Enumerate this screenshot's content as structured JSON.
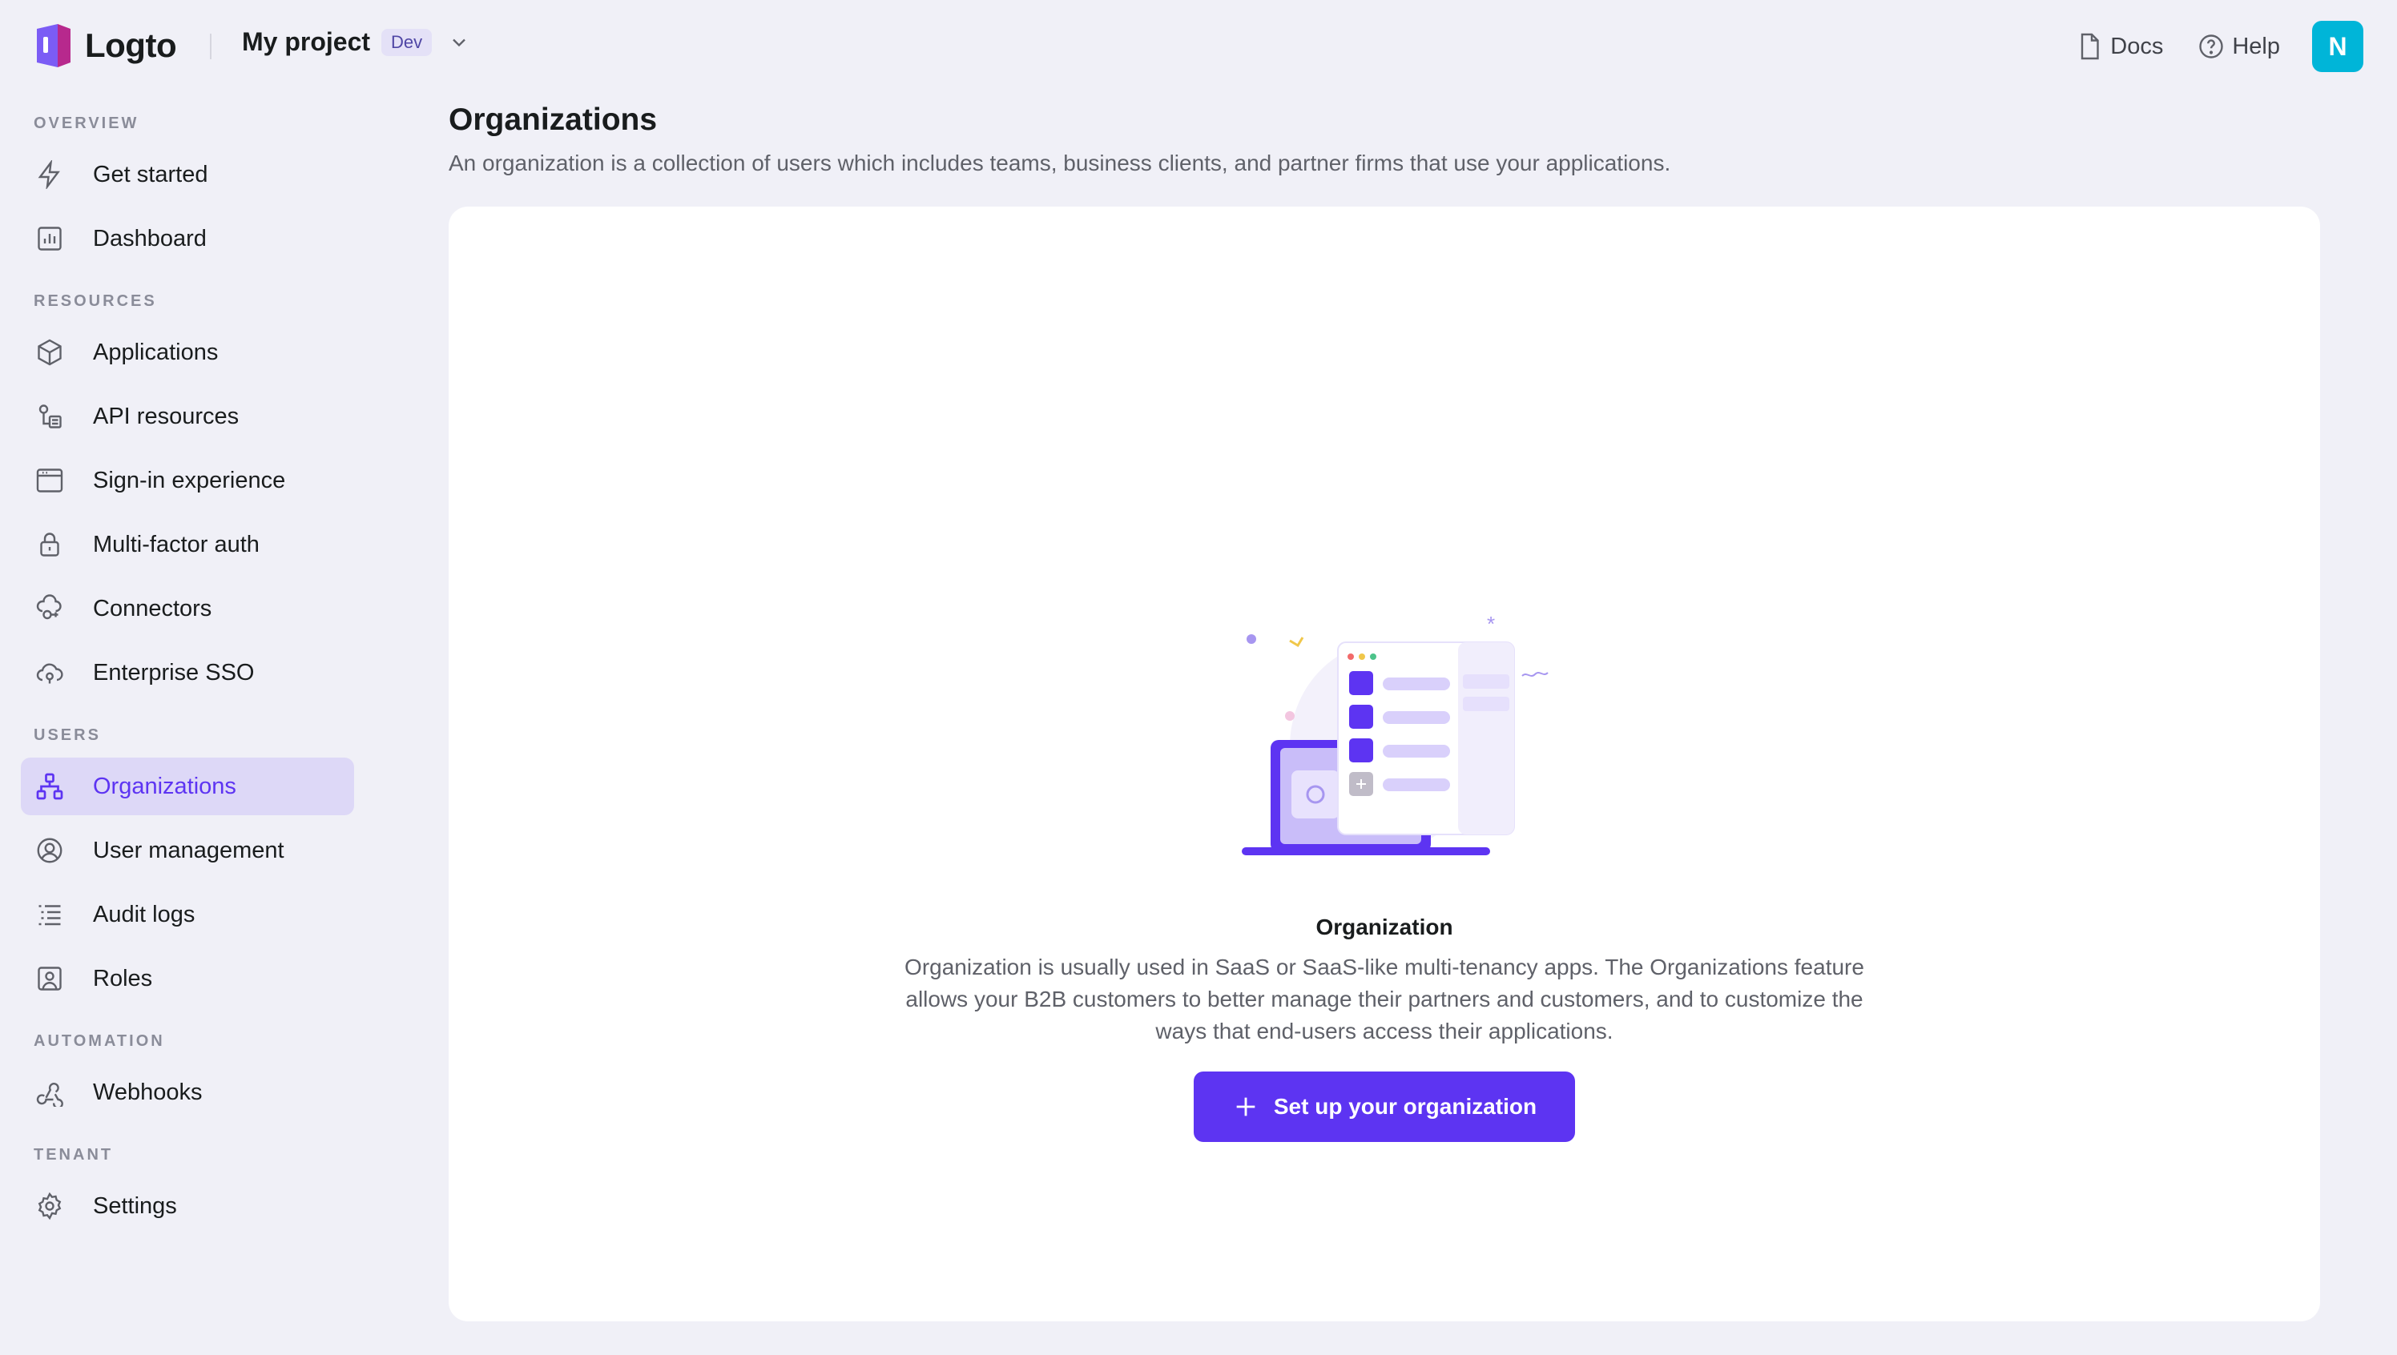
{
  "topbar": {
    "brand": "Logto",
    "project_name": "My project",
    "env_badge": "Dev",
    "links": [
      {
        "label": "Docs",
        "icon": "document-icon"
      },
      {
        "label": "Help",
        "icon": "help-circle-icon"
      }
    ],
    "avatar_initial": "N"
  },
  "sidebar": {
    "sections": [
      {
        "title": "OVERVIEW",
        "items": [
          {
            "label": "Get started",
            "icon": "bolt-icon"
          },
          {
            "label": "Dashboard",
            "icon": "bar-chart-icon"
          }
        ]
      },
      {
        "title": "RESOURCES",
        "items": [
          {
            "label": "Applications",
            "icon": "cube-icon"
          },
          {
            "label": "API resources",
            "icon": "api-icon"
          },
          {
            "label": "Sign-in experience",
            "icon": "browser-icon"
          },
          {
            "label": "Multi-factor auth",
            "icon": "lock-icon"
          },
          {
            "label": "Connectors",
            "icon": "connector-icon"
          },
          {
            "label": "Enterprise SSO",
            "icon": "cloud-sso-icon"
          }
        ]
      },
      {
        "title": "USERS",
        "items": [
          {
            "label": "Organizations",
            "icon": "organization-icon",
            "active": true
          },
          {
            "label": "User management",
            "icon": "user-circle-icon"
          },
          {
            "label": "Audit logs",
            "icon": "list-icon"
          },
          {
            "label": "Roles",
            "icon": "user-badge-icon"
          }
        ]
      },
      {
        "title": "AUTOMATION",
        "items": [
          {
            "label": "Webhooks",
            "icon": "webhook-icon"
          }
        ]
      },
      {
        "title": "TENANT",
        "items": [
          {
            "label": "Settings",
            "icon": "gear-icon"
          }
        ]
      }
    ]
  },
  "main": {
    "title": "Organizations",
    "subtitle": "An organization is a collection of users which includes teams, business clients, and partner firms that use your applications.",
    "empty_state": {
      "title": "Organization",
      "description": "Organization is usually used in SaaS or SaaS-like multi-tenancy apps. The Organizations feature allows your B2B customers to better manage their partners and customers, and to customize the ways that end-users access their applications.",
      "cta_label": "Set up your organization"
    }
  },
  "colors": {
    "accent": "#5d34f2",
    "active_bg": "#ddd8f7",
    "avatar": "#00b5d8",
    "background": "#f0f0f7"
  }
}
